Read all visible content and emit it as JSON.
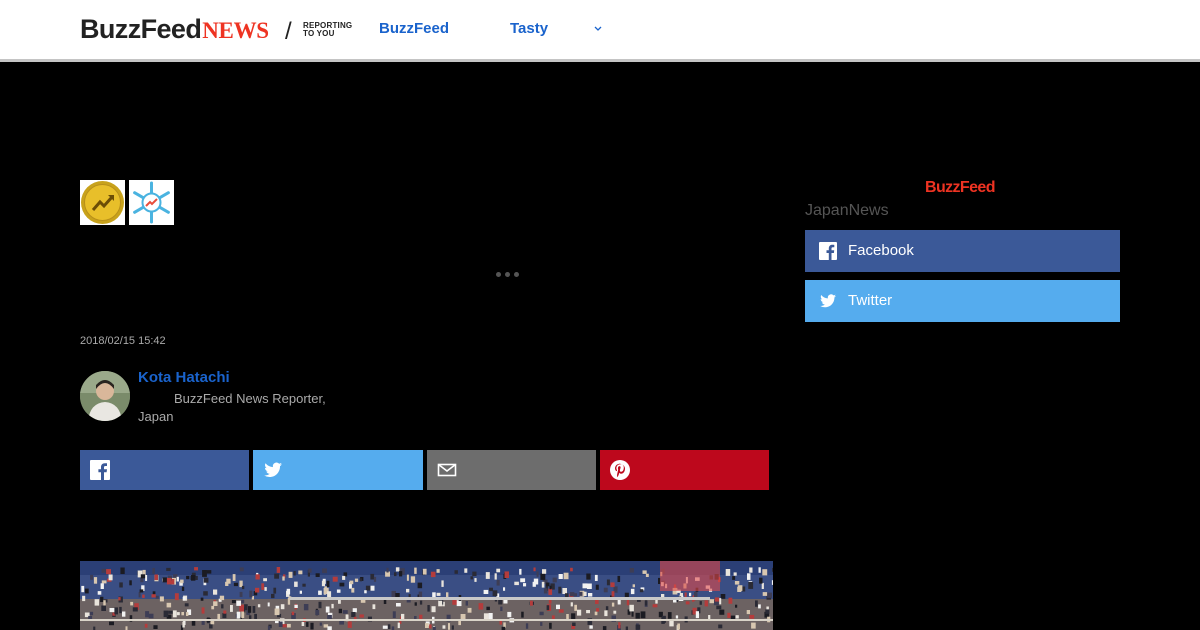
{
  "header": {
    "logo_buzz": "BuzzFeed",
    "logo_news": "NEWS",
    "logo_slash": "/",
    "logo_tagline": "REPORTING TO YOU",
    "nav": [
      {
        "label": "BuzzFeed"
      },
      {
        "label": "Tasty"
      }
    ]
  },
  "article": {
    "timestamp": "2018/02/15 15:42",
    "author": {
      "name": "Kota Hatachi",
      "title": "BuzzFeed News Reporter, Japan"
    }
  },
  "sidebar": {
    "logo": "BuzzFeed",
    "label": "JapanNews",
    "follow": [
      {
        "label": "Facebook"
      },
      {
        "label": "Twitter"
      }
    ]
  },
  "colors": {
    "facebook": "#3b5998",
    "twitter": "#55acee",
    "mail": "#6d6d6d",
    "pinterest": "#bd081c",
    "link_blue": "#1a63cc",
    "brand_red": "#e32"
  },
  "icons": [
    "facebook-icon",
    "twitter-icon",
    "mail-icon",
    "pinterest-icon",
    "chevron-down-icon"
  ]
}
